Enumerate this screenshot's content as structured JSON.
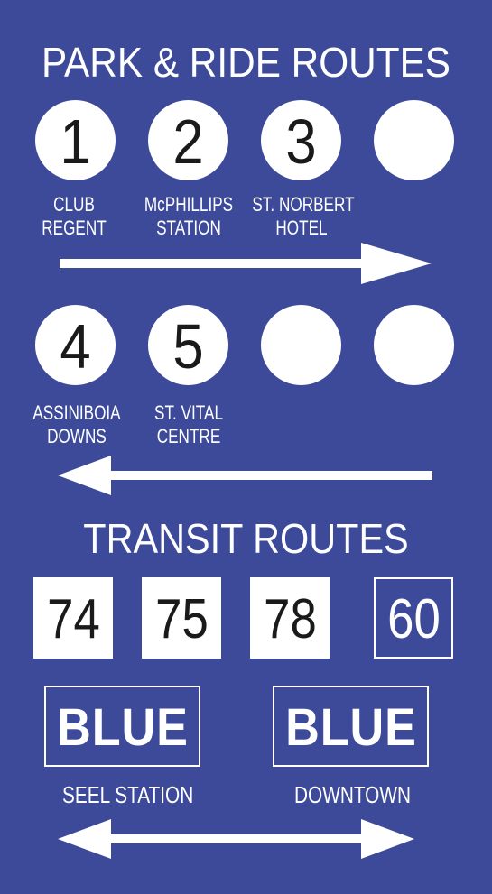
{
  "park_and_ride": {
    "title": "PARK & RIDE ROUTES",
    "row1": {
      "direction": "right",
      "stops": [
        {
          "number": "1",
          "label_line1": "CLUB",
          "label_line2": "REGENT"
        },
        {
          "number": "2",
          "label_line1": "McPHILLIPS",
          "label_line2": "STATION"
        },
        {
          "number": "3",
          "label_line1": "ST. NORBERT",
          "label_line2": "HOTEL"
        },
        {
          "number": "",
          "label_line1": "",
          "label_line2": ""
        }
      ]
    },
    "row2": {
      "direction": "left",
      "stops": [
        {
          "number": "4",
          "label_line1": "ASSINIBOIA",
          "label_line2": "DOWNS"
        },
        {
          "number": "5",
          "label_line1": "ST. VITAL",
          "label_line2": "CENTRE"
        },
        {
          "number": "",
          "label_line1": "",
          "label_line2": ""
        },
        {
          "number": "",
          "label_line1": "",
          "label_line2": ""
        }
      ]
    }
  },
  "transit": {
    "title": "TRANSIT ROUTES",
    "routes": [
      {
        "number": "74",
        "style": "filled"
      },
      {
        "number": "75",
        "style": "filled"
      },
      {
        "number": "78",
        "style": "filled"
      },
      {
        "number": "60",
        "style": "outline"
      }
    ],
    "blue_line": {
      "left": {
        "label": "BLUE",
        "destination": "SEEL STATION"
      },
      "right": {
        "label": "BLUE",
        "destination": "DOWNTOWN"
      },
      "direction": "both"
    }
  },
  "colors": {
    "background": "#3c4a99",
    "foreground": "#ffffff",
    "numeral": "#1a1a1a"
  }
}
